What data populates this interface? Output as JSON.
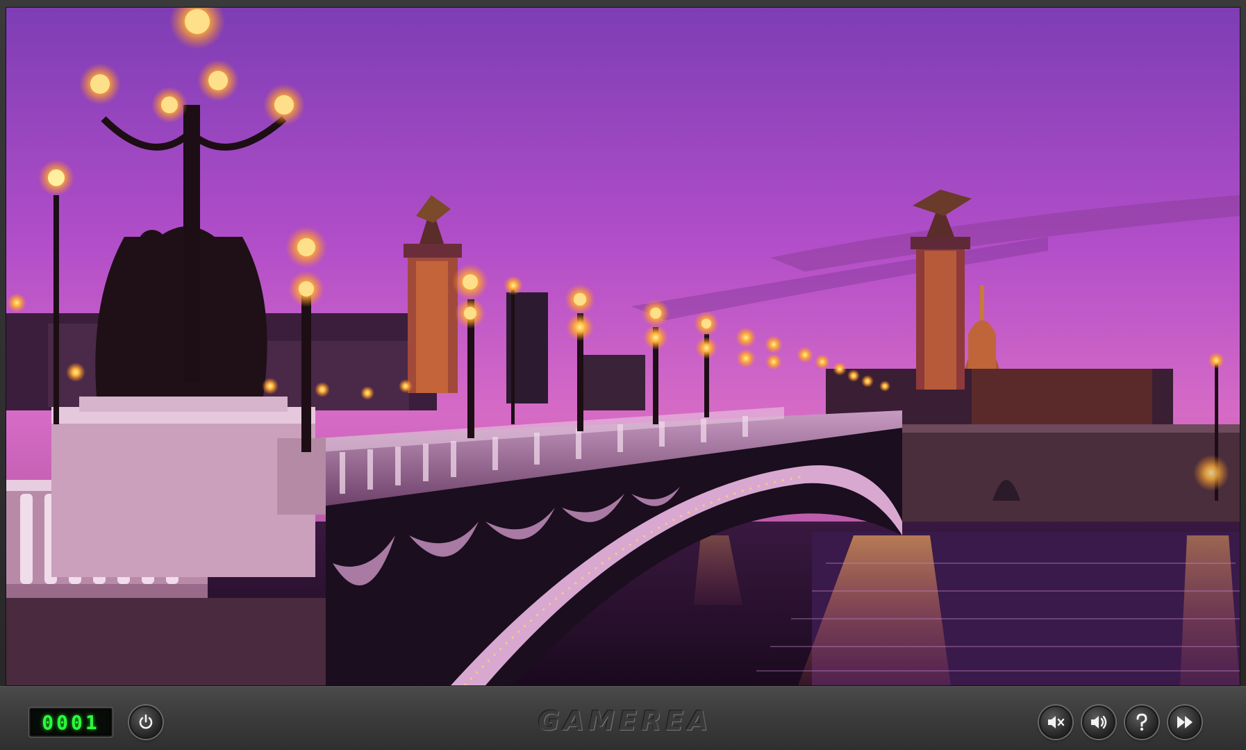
{
  "game": {
    "counter": "0001",
    "logo": "GAMEREA",
    "scene_image": "paris-pont-alexandre-iii-sunset"
  },
  "controls": {
    "power": "power-icon",
    "mute": "mute-icon",
    "volume": "volume-icon",
    "help": "help-icon",
    "skip": "skip-icon"
  },
  "colors": {
    "counter_digits": "#2aff3a",
    "sky_top": "#7a3fb0",
    "sky_mid": "#c45ad0",
    "sky_low": "#e67fb8",
    "lamp_glow": "#ffb23a"
  }
}
